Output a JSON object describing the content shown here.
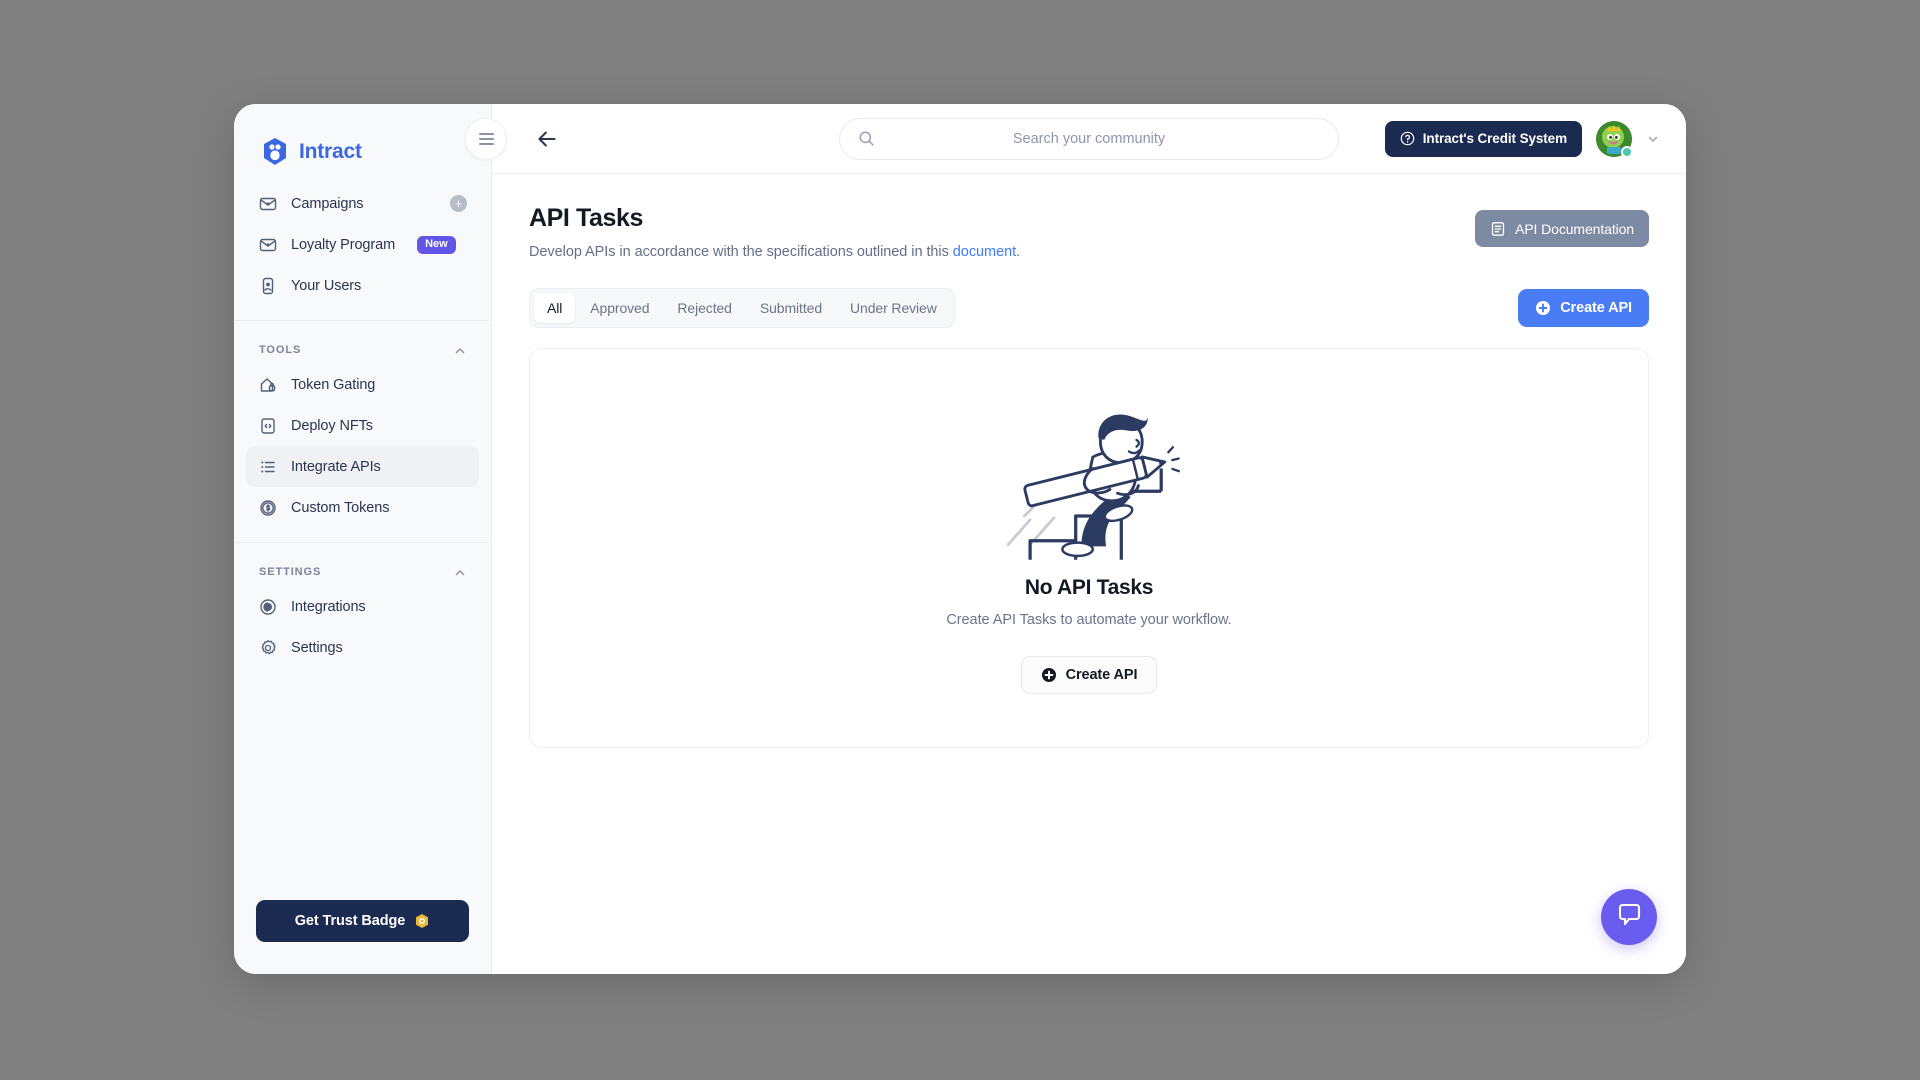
{
  "brand": {
    "name": "Intract",
    "logo_icon": "intract-hex-logo"
  },
  "sidebar": {
    "primary_items": [
      {
        "label": "Campaigns",
        "icon": "campaign-icon",
        "action_icon": "plus-circle-icon"
      },
      {
        "label": "Loyalty Program",
        "icon": "loyalty-icon",
        "badge": "New"
      },
      {
        "label": "Your Users",
        "icon": "users-icon"
      }
    ],
    "groups": [
      {
        "title": "TOOLS",
        "collapse_icon": "chevron-up-icon",
        "items": [
          {
            "label": "Token Gating",
            "icon": "token-gating-icon",
            "active": false
          },
          {
            "label": "Deploy NFTs",
            "icon": "deploy-nfts-icon",
            "active": false
          },
          {
            "label": "Integrate APIs",
            "icon": "integrate-apis-icon",
            "active": true
          },
          {
            "label": "Custom Tokens",
            "icon": "custom-tokens-icon",
            "active": false
          }
        ]
      },
      {
        "title": "SETTINGS",
        "collapse_icon": "chevron-up-icon",
        "items": [
          {
            "label": "Integrations",
            "icon": "integrations-icon",
            "active": false
          },
          {
            "label": "Settings",
            "icon": "gear-icon",
            "active": false
          }
        ]
      }
    ],
    "footer": {
      "trust_badge_label": "Get Trust Badge",
      "trust_badge_icon": "shield-coin-icon"
    }
  },
  "topbar": {
    "menu_icon": "hamburger-icon",
    "back_icon": "arrow-left-icon",
    "search": {
      "placeholder": "Search your community",
      "value": "",
      "icon": "search-icon"
    },
    "credit_button": {
      "label": "Intract's Credit System",
      "icon": "question-circle-icon"
    },
    "avatar": {
      "name": "user-avatar",
      "status": "online"
    },
    "dropdown_icon": "chevron-down-icon"
  },
  "page": {
    "title": "API Tasks",
    "subtitle_prefix": "Develop APIs in accordance with the specifications outlined in this ",
    "subtitle_link": "document",
    "subtitle_suffix": ".",
    "doc_button": {
      "label": "API Documentation",
      "icon": "document-icon"
    },
    "create_button": {
      "label": "Create API",
      "icon": "plus-circle-icon"
    },
    "tabs": [
      {
        "label": "All",
        "active": true
      },
      {
        "label": "Approved",
        "active": false
      },
      {
        "label": "Rejected",
        "active": false
      },
      {
        "label": "Submitted",
        "active": false
      },
      {
        "label": "Under Review",
        "active": false
      }
    ],
    "empty_state": {
      "illustration": "person-climbing-stairs-with-pencil",
      "title": "No API Tasks",
      "subtitle": "Create API Tasks to automate your workflow.",
      "button": {
        "label": "Create API",
        "icon": "plus-circle-icon"
      }
    }
  },
  "chat_widget": {
    "icon": "chat-bubble-icon"
  },
  "colors": {
    "brand_blue": "#3b68e0",
    "primary_blue": "#4a7cf5",
    "navy": "#1b2a50",
    "link_blue": "#3e7bfa",
    "badge_purple": "#6255e6",
    "doc_button_gray": "#7d8aa3",
    "chat_purple": "#6b5cf0",
    "page_background": "#808080"
  }
}
